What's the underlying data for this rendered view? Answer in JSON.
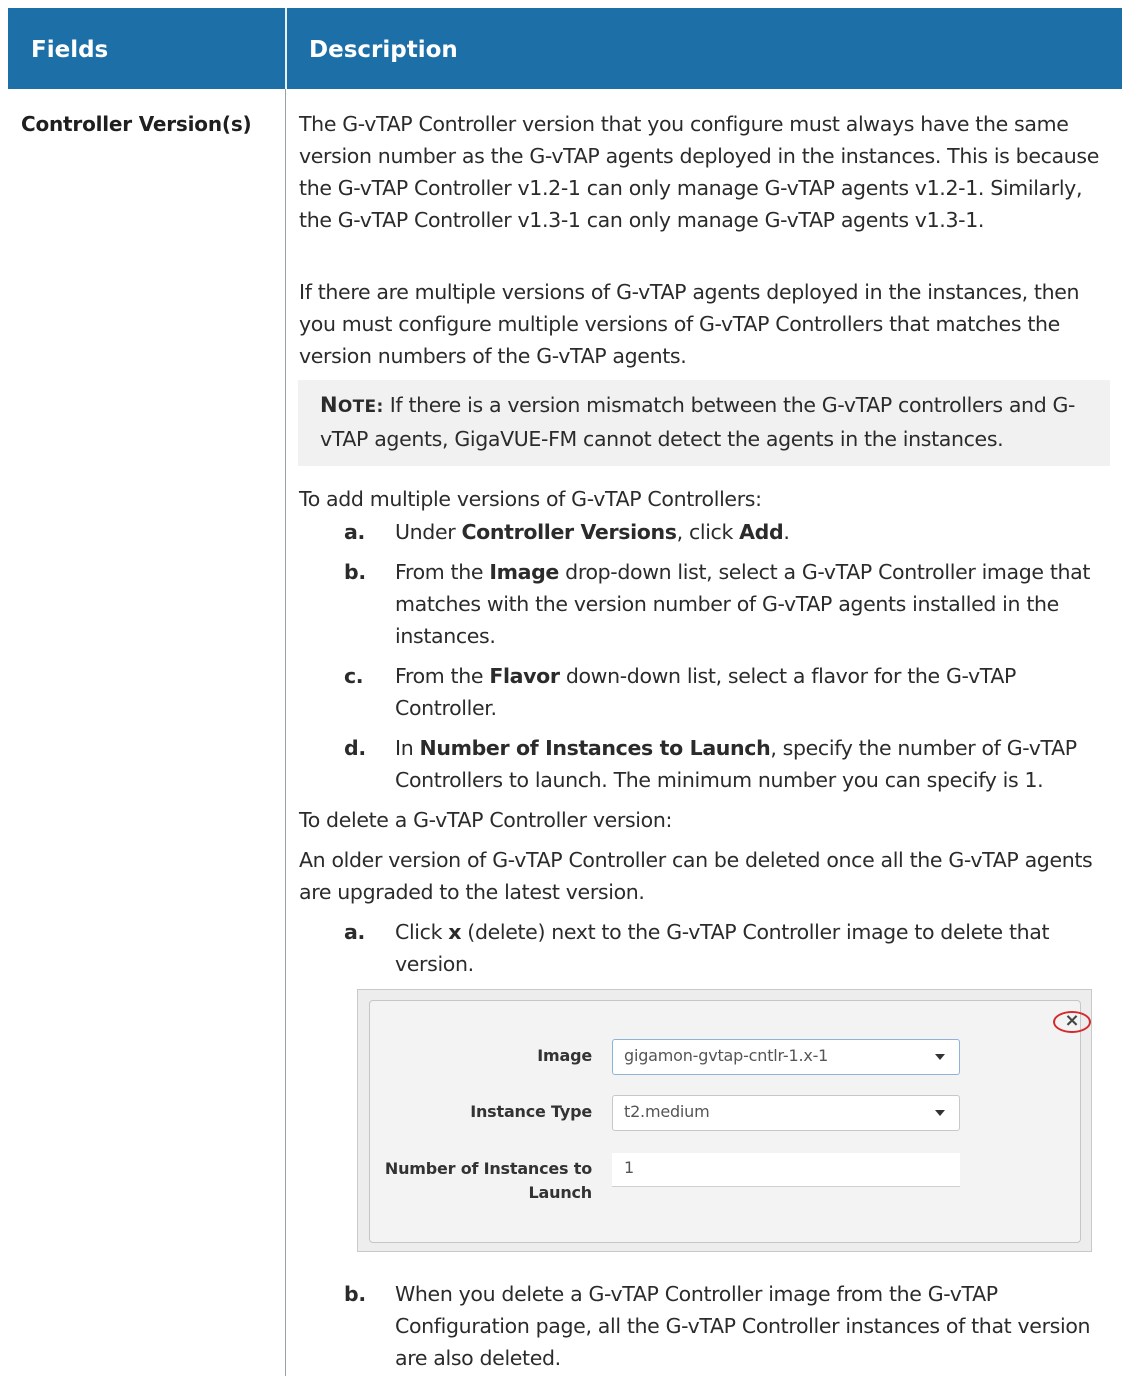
{
  "header": {
    "fields_label": "Fields",
    "description_label": "Description"
  },
  "row": {
    "field_name": "Controller Version(s)",
    "p1": "The G-vTAP Controller version that you configure must always have the same version number as the G-vTAP agents deployed in the instances. This is because the G-vTAP Controller v1.2-1 can only manage G-vTAP agents v1.2-1. Similarly, the G-vTAP Controller v1.3-1 can only manage G-vTAP agents v1.3-1.",
    "p2": "If there are multiple versions of G-vTAP agents deployed in the instances, then you must configure multiple versions of G-vTAP Controllers that matches the version numbers of the G-vTAP agents.",
    "note_label_first": "N",
    "note_label_rest": "OTE:",
    "note_text": " If there is a version mismatch between the G-vTAP controllers and G-vTAP agents, GigaVUE-FM cannot detect the agents in the instances.",
    "p3": "To add multiple versions of G-vTAP Controllers:",
    "add_steps": {
      "a": {
        "letter": "a.",
        "t1": "Under ",
        "b1": "Controller Versions",
        "t2": ", click ",
        "b2": "Add",
        "t3": "."
      },
      "b": {
        "letter": "b.",
        "t1": "From the ",
        "b1": "Image",
        "t2": " drop-down list, select a G-vTAP Controller image that matches with the version number of G-vTAP agents installed in the instances."
      },
      "c": {
        "letter": "c.",
        "t1": "From the ",
        "b1": "Flavor",
        "t2": " down-down list, select a flavor for the G-vTAP Controller."
      },
      "d": {
        "letter": "d.",
        "t1": "In ",
        "b1": "Number of Instances to Launch",
        "t2": ", specify the number of G-vTAP Controllers to launch. The minimum number you can specify is 1."
      }
    },
    "p4": "To delete a G-vTAP Controller version:",
    "p5": "An older version of G-vTAP Controller can be deleted once all the G-vTAP agents are upgraded to the latest version.",
    "delete_steps": {
      "a": {
        "letter": "a.",
        "t1": "Click ",
        "b1": "x",
        "t2": " (delete) next to the G-vTAP Controller image to delete that version."
      },
      "b": {
        "letter": "b.",
        "t1": "When you delete a G-vTAP Controller image from the G-vTAP Configuration page, all the G-vTAP Controller instances of that version are also deleted."
      }
    }
  },
  "dialog": {
    "close_glyph": "×",
    "image_label": "Image",
    "image_value": "gigamon-gvtap-cntlr-1.x-1",
    "instance_type_label": "Instance Type",
    "instance_type_value": "t2.medium",
    "count_label_line1": "Number of Instances to",
    "count_label_line2": "Launch",
    "count_value": "1"
  }
}
